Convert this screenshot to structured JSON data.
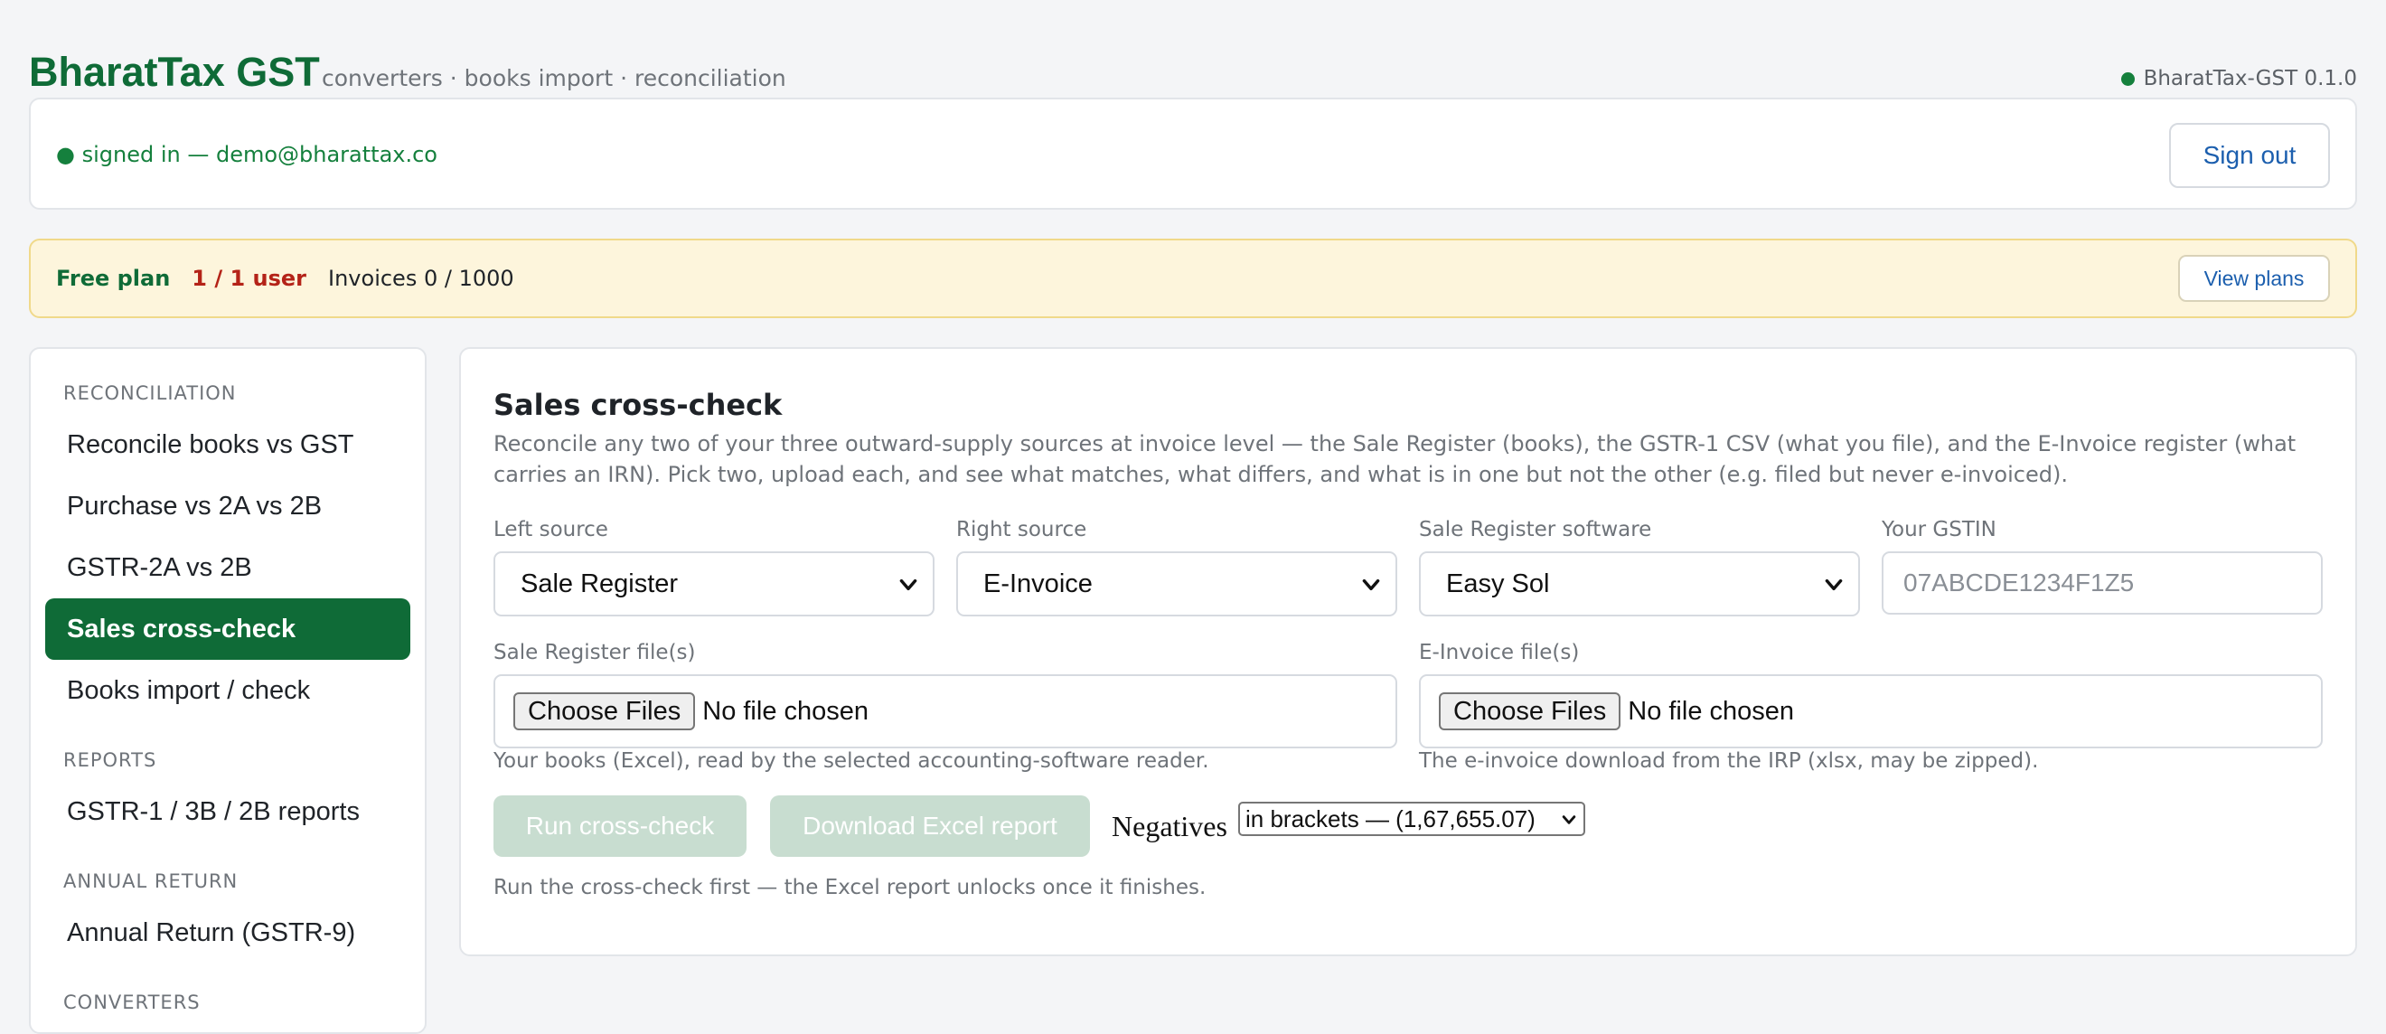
{
  "header": {
    "title": "BharatTax GST",
    "tagline": "converters · books import · reconciliation",
    "version": "BharatTax-GST 0.1.0",
    "status_color": "#15803d"
  },
  "session": {
    "signed_in_text": "● signed in — demo@bharattax.co",
    "sign_out_label": "Sign out"
  },
  "plan": {
    "name": "Free plan",
    "users": "1 / 1 user",
    "invoices": "Invoices 0 / 1000",
    "view_plans_label": "View plans"
  },
  "sidebar": {
    "sections": [
      {
        "label": "RECONCILIATION"
      },
      {
        "label": "REPORTS"
      },
      {
        "label": "ANNUAL RETURN"
      },
      {
        "label": "CONVERTERS"
      }
    ],
    "items": [
      {
        "label": "Reconcile books vs GST"
      },
      {
        "label": "Purchase vs 2A vs 2B"
      },
      {
        "label": "GSTR-2A vs 2B"
      },
      {
        "label": "Sales cross-check",
        "active": true
      },
      {
        "label": "Books import / check"
      },
      {
        "label": "GSTR-1 / 3B / 2B reports"
      },
      {
        "label": "Annual Return (GSTR-9)"
      }
    ],
    "accent_color": "#0f6b37"
  },
  "main": {
    "title": "Sales cross-check",
    "description": "Reconcile any two of your three outward-supply sources at invoice level — the Sale Register (books), the GSTR-1 CSV (what you file), and the E-Invoice register (what carries an IRN). Pick two, upload each, and see what matches, what differs, and what is in one but not the other (e.g. filed but never e-invoiced).",
    "fields": {
      "left_source": {
        "label": "Left source",
        "value": "Sale Register"
      },
      "right_source": {
        "label": "Right source",
        "value": "E-Invoice"
      },
      "software": {
        "label": "Sale Register software",
        "value": "Easy Sol"
      },
      "gstin": {
        "label": "Your GSTIN",
        "placeholder": "07ABCDE1234F1Z5"
      }
    },
    "uploads": {
      "left": {
        "label": "Sale Register file(s)",
        "button": "Choose Files",
        "status": "No file chosen",
        "hint": "Your books (Excel), read by the selected accounting-software reader."
      },
      "right": {
        "label": "E-Invoice file(s)",
        "button": "Choose Files",
        "status": "No file chosen",
        "hint": "The e-invoice download from the IRP (xlsx, may be zipped)."
      }
    },
    "actions": {
      "run_label": "Run cross-check",
      "download_label": "Download Excel report",
      "negatives_label": "Negatives",
      "negatives_value": "in brackets — (1,67,655.07)",
      "footer_hint": "Run the cross-check first — the Excel report unlocks once it finishes."
    }
  }
}
